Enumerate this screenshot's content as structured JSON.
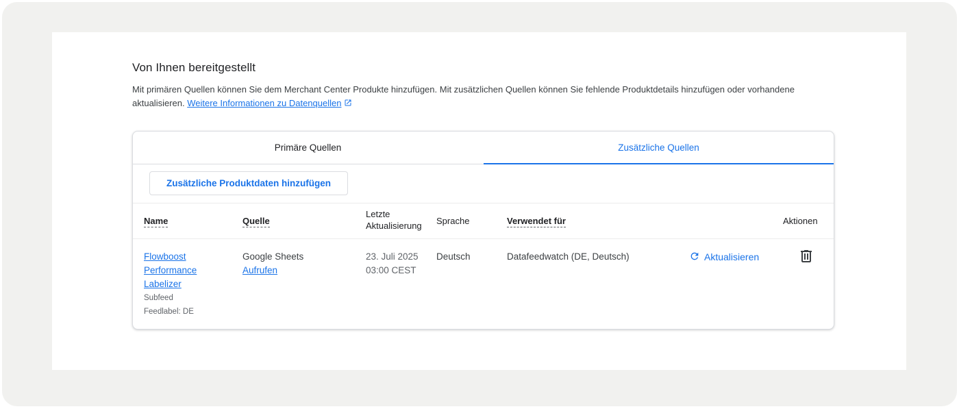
{
  "section": {
    "title": "Von Ihnen bereitgestellt",
    "description": "Mit primären Quellen können Sie dem Merchant Center Produkte hinzufügen. Mit zusätzlichen Quellen können Sie fehlende Produktdetails hinzufügen oder vorhandene aktualisieren.",
    "learn_more_link": "Weitere Informationen zu Datenquellen",
    "learn_more_icon": "open-in-new-icon"
  },
  "tabs": [
    {
      "label": "Primäre Quellen",
      "active": false
    },
    {
      "label": "Zusätzliche Quellen",
      "active": true
    }
  ],
  "add_button_label": "Zusätzliche Produktdaten hinzufügen",
  "table": {
    "headers": {
      "name": "Name",
      "source": "Quelle",
      "updated_line1": "Letzte",
      "updated_line2": "Aktualisierung",
      "language": "Sprache",
      "used_for": "Verwendet für",
      "actions": "Aktionen"
    },
    "rows": [
      {
        "name_line1": "Flowboost",
        "name_line2": "Performance",
        "name_line3": "Labelizer",
        "type": "Subfeed",
        "feed_label": "Feedlabel: DE",
        "source": "Google Sheets",
        "source_link": "Aufrufen",
        "updated_date": "23. Juli 2025",
        "updated_time": "03:00 CEST",
        "language": "Deutsch",
        "used_for": "Datafeedwatch (DE, Deutsch)",
        "refresh_label": "Aktualisieren",
        "refresh_icon": "refresh-icon",
        "delete_icon": "trash-icon"
      }
    ]
  },
  "colors": {
    "accent": "#1a73e8",
    "frame_background": "#f1f1ef",
    "text_primary": "#202124",
    "text_secondary": "#5f6368"
  }
}
